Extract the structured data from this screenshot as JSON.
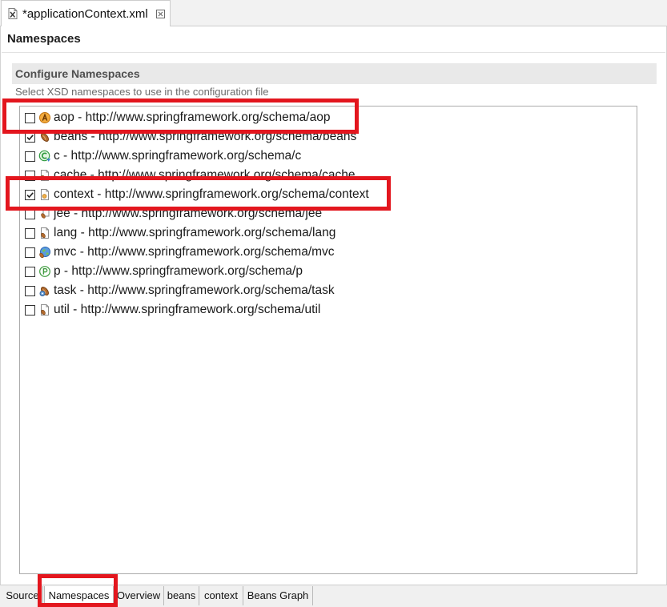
{
  "editor_tab": {
    "title": "*applicationContext.xml",
    "icon": "xml-file-icon",
    "close_icon": "close-icon"
  },
  "page_title": "Namespaces",
  "section": {
    "title": "Configure Namespaces",
    "description": "Select XSD namespaces to use in the configuration file"
  },
  "namespaces": [
    {
      "label": "aop - http://www.springframework.org/schema/aop",
      "checked": false,
      "icon": "aop-badge-icon"
    },
    {
      "label": "beans - http://www.springframework.org/schema/beans",
      "checked": true,
      "icon": "bean-icon"
    },
    {
      "label": "c - http://www.springframework.org/schema/c",
      "checked": false,
      "icon": "c-badge-icon"
    },
    {
      "label": "cache - http://www.springframework.org/schema/cache",
      "checked": false,
      "icon": "cache-document-icon"
    },
    {
      "label": "context - http://www.springframework.org/schema/context",
      "checked": true,
      "icon": "context-document-icon"
    },
    {
      "label": "jee - http://www.springframework.org/schema/jee",
      "checked": false,
      "icon": "jee-bean-icon"
    },
    {
      "label": "lang - http://www.springframework.org/schema/lang",
      "checked": false,
      "icon": "lang-document-icon"
    },
    {
      "label": "mvc - http://www.springframework.org/schema/mvc",
      "checked": false,
      "icon": "mvc-globe-icon"
    },
    {
      "label": "p - http://www.springframework.org/schema/p",
      "checked": false,
      "icon": "p-badge-icon"
    },
    {
      "label": "task - http://www.springframework.org/schema/task",
      "checked": false,
      "icon": "task-bean-icon"
    },
    {
      "label": "util - http://www.springframework.org/schema/util",
      "checked": false,
      "icon": "util-document-icon"
    }
  ],
  "bottom_tabs": [
    {
      "label": "Source",
      "selected": false
    },
    {
      "label": "Namespaces",
      "selected": true
    },
    {
      "label": "Overview",
      "selected": false
    },
    {
      "label": "beans",
      "selected": false
    },
    {
      "label": "context",
      "selected": false
    },
    {
      "label": "Beans Graph",
      "selected": false
    }
  ],
  "colors": {
    "highlight": "#e3161e"
  }
}
